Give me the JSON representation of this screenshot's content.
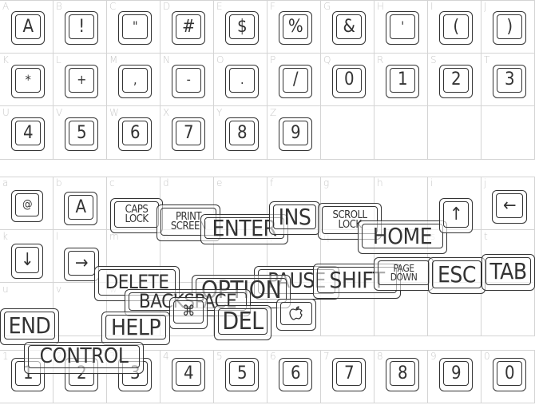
{
  "sections": [
    {
      "name": "uppercase",
      "cells": [
        {
          "label": "A",
          "key": "A"
        },
        {
          "label": "B",
          "key": "!"
        },
        {
          "label": "C",
          "key": "\""
        },
        {
          "label": "D",
          "key": "#"
        },
        {
          "label": "E",
          "key": "$"
        },
        {
          "label": "F",
          "key": "%"
        },
        {
          "label": "G",
          "key": "&"
        },
        {
          "label": "H",
          "key": "'"
        },
        {
          "label": "I",
          "key": "("
        },
        {
          "label": "J",
          "key": ")"
        },
        {
          "label": "K",
          "key": "*"
        },
        {
          "label": "L",
          "key": "+"
        },
        {
          "label": "M",
          "key": ","
        },
        {
          "label": "N",
          "key": "-"
        },
        {
          "label": "O",
          "key": "."
        },
        {
          "label": "P",
          "key": "/"
        },
        {
          "label": "Q",
          "key": "0"
        },
        {
          "label": "R",
          "key": "1"
        },
        {
          "label": "S",
          "key": "2"
        },
        {
          "label": "T",
          "key": "3"
        },
        {
          "label": "U",
          "key": "4"
        },
        {
          "label": "V",
          "key": "5"
        },
        {
          "label": "W",
          "key": "6"
        },
        {
          "label": "X",
          "key": "7"
        },
        {
          "label": "Y",
          "key": "8"
        },
        {
          "label": "Z",
          "key": "9"
        },
        {
          "label": "",
          "key": ""
        },
        {
          "label": "",
          "key": ""
        },
        {
          "label": "",
          "key": ""
        },
        {
          "label": "",
          "key": ""
        }
      ]
    },
    {
      "name": "lowercase",
      "cells": [
        {
          "label": "a"
        },
        {
          "label": "b"
        },
        {
          "label": "c"
        },
        {
          "label": "d"
        },
        {
          "label": "e"
        },
        {
          "label": "f"
        },
        {
          "label": "g"
        },
        {
          "label": "h"
        },
        {
          "label": "i"
        },
        {
          "label": "j"
        },
        {
          "label": "k"
        },
        {
          "label": "l"
        },
        {
          "label": "m"
        },
        {
          "label": "n"
        },
        {
          "label": "o"
        },
        {
          "label": "p"
        },
        {
          "label": "q"
        },
        {
          "label": "r"
        },
        {
          "label": "s"
        },
        {
          "label": "t"
        },
        {
          "label": "u"
        },
        {
          "label": "v"
        },
        {
          "label": "w"
        },
        {
          "label": "x"
        },
        {
          "label": "y"
        },
        {
          "label": "z"
        },
        {
          "label": ""
        },
        {
          "label": ""
        },
        {
          "label": ""
        },
        {
          "label": ""
        }
      ],
      "keys": [
        "@",
        "A",
        "CAPS\nLOCK",
        "PRINT\nSCREEN",
        "ENTER",
        "INS",
        "SCROLL\nLOCK",
        "HOME",
        "↑",
        "←",
        "↓",
        "→",
        "DELETE",
        "PAUSE",
        "OPTION",
        "SHIFT",
        "PAGE\nDOWN",
        "ESC",
        "TAB",
        "BACKSPACE",
        "⌘",
        "",
        "END",
        "HELP",
        "DEL",
        "CONTROL"
      ]
    },
    {
      "name": "digits",
      "cells": [
        {
          "label": "1",
          "key": "1"
        },
        {
          "label": "2",
          "key": "2"
        },
        {
          "label": "3",
          "key": "3"
        },
        {
          "label": "4",
          "key": "4"
        },
        {
          "label": "5",
          "key": "5"
        },
        {
          "label": "6",
          "key": "6"
        },
        {
          "label": "7",
          "key": "7"
        },
        {
          "label": "8",
          "key": "8"
        },
        {
          "label": "9",
          "key": "9"
        },
        {
          "label": "0",
          "key": "0"
        }
      ]
    }
  ],
  "colors": {
    "grid": "#d4d4d4",
    "key_stroke": "#333333",
    "cell_label": "#c8c8c8"
  }
}
